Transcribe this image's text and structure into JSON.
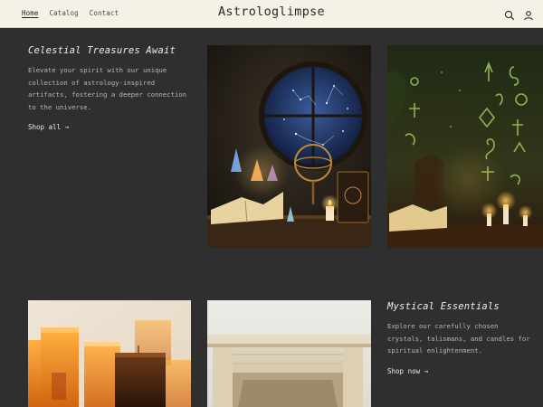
{
  "header": {
    "nav": [
      {
        "label": "Home",
        "active": true
      },
      {
        "label": "Catalog",
        "active": false
      },
      {
        "label": "Contact",
        "active": false
      }
    ],
    "logo": "Astrologlimpse",
    "icons": [
      "search-icon",
      "account-icon"
    ]
  },
  "section1": {
    "title": "Celestial Treasures Await",
    "body": "Elevate your spirit with our unique collection of astrology-inspired artifacts, fostering a deeper connection to the universe.",
    "cta": "Shop all →"
  },
  "section2": {
    "title": "Mystical Essentials",
    "body": "Explore our carefully chosen crystals, talismans, and candles for spiritual enlightenment.",
    "cta": "Shop now →"
  },
  "colors": {
    "background": "#2f2f2f",
    "header": "#f6f1e6",
    "accent": "#e0a54a"
  }
}
